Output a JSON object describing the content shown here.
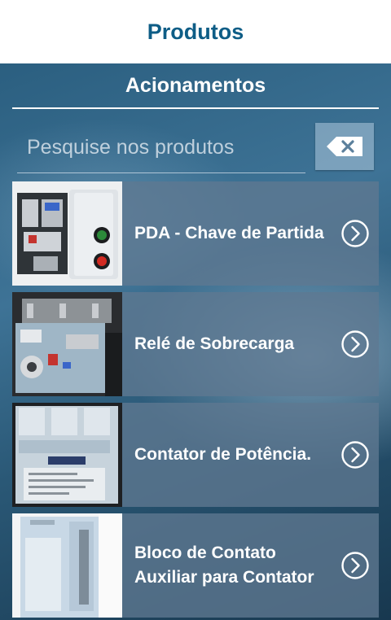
{
  "topbar": {
    "title": "Produtos"
  },
  "section": {
    "title": "Acionamentos"
  },
  "search": {
    "placeholder": "Pesquise nos produtos",
    "value": ""
  },
  "products": [
    {
      "label": "PDA - Chave de Partida"
    },
    {
      "label": "Relé de Sobrecarga"
    },
    {
      "label": "Contator de Potência."
    },
    {
      "label": "Bloco de Contato Auxiliar para Contator"
    }
  ],
  "icons": {
    "clear": "backspace-icon",
    "item_arrow": "chevron-right-circle-icon"
  },
  "colors": {
    "title": "#0e5d86",
    "topbar_bg": "#ffffff",
    "text": "#ffffff"
  }
}
